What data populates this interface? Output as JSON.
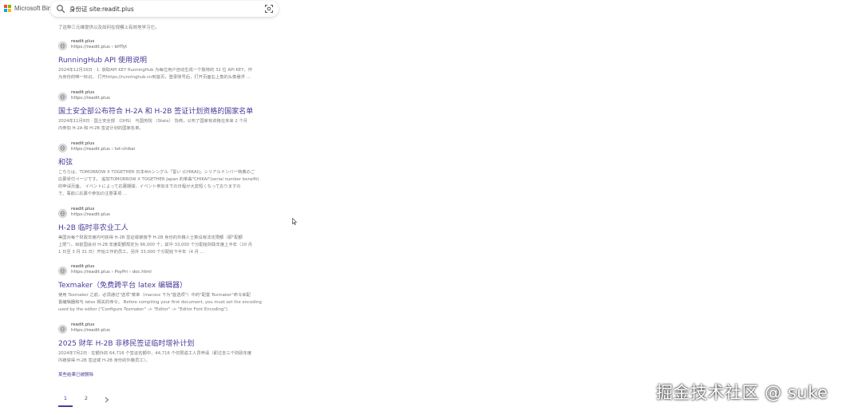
{
  "header": {
    "logo_text": "Microsoft Bing",
    "logo_colors": [
      "#f25022",
      "#7fba00",
      "#00a4ef",
      "#ffb900"
    ],
    "search_query": "身份证 site:readit.plus"
  },
  "top_snippet": {
    "line1": "",
    "line2": "了这种三元维提供以及如何在规模上有效地学习它。"
  },
  "results": [
    {
      "site_name": "readit.plus",
      "site_url": "https://readit.plus › bHTyt",
      "title": "RunningHub API 使用说明",
      "snippet": [
        "2024年12月16日 · 1. 获取API KEY RunningHub 为每位用户自动生成一个独特的 32 位 API KEY，作",
        "为身份的唯一标识。 打开https://runninghub.cn到首页，登录账号后，打开页面右上角的头像悬浮 …"
      ]
    },
    {
      "site_name": "readit.plus",
      "site_url": "https://readit.plus",
      "title": "国土安全部公布符合 H-2A 和 H-2B 签证计划资格的国家名单",
      "snippet": [
        "2024年11月8日 · 国土安全部 （DHS） 与国务院 （State） 协商，公布了国家有资格在未来 2 个月",
        "内参加 H-2A 和 H-2B 签证计划的国家名单。"
      ]
    },
    {
      "site_name": "readit.plus",
      "site_url": "https://readit.plus › txt-chikai",
      "title": "和弦",
      "snippet": [
        "こちらは、TOMORROW X TOGETHER 日本4thシングル「誓い (CHIKAI)」シリアルナンバー特典のご",
        "応募受付ページです。 追加TOMORROW X TOGETHER Japan 的单曲\"CHIKAI\"(serial number benefit)",
        "的申请页面。 イベントによって応募期間、イベント参加までの日程が大変短くなっておりますの",
        "で、事前に応募や参加の注意事項 …"
      ]
    },
    {
      "site_name": "readit.plus",
      "site_url": "https://readit.plus",
      "title": "H-2B 临时非农业工人",
      "snippet": [
        "美国对每个财政年度内可获得 H-2B 签证或被授予 H-2B 身份的外籍人士数设有法定限额（即\"配额",
        "上限\"）。目前国会对 H-2B 年度配额规定为 66,000 个，其中 33,000 个分配给财政年度上半年（10 月",
        "1 日至 3 月 31 日）开始工作的员工，另外 33,000 个分配给下半年（4 月 …"
      ]
    },
    {
      "site_name": "readit.plus",
      "site_url": "https://readit.plus › PsyPri › doc.html",
      "title": "Texmaker（免费跨平台 latex 编辑器）",
      "snippet": [
        "使用 Texmaker 之前，必须通过\"选项\"菜单（macosx 下为\"首选项\"）中的\"配置 Texmaker\"命令来配",
        "置编辑器和与 latex 相关的命令。 Before compiling your first document, you must set the encoding",
        "used by the editor (\"Configure Texmaker\" -> \"Editor\" -> \"Editor Font Encoding\")."
      ]
    },
    {
      "site_name": "readit.plus",
      "site_url": "https://readit.plus",
      "title": "2025 财年 H-2B 非移民签证临时增补计划",
      "snippet": [
        "2024年7月2日 · 在额外的 64,716 个签证名额中，44,716 个仅限返工人员申请（即过去三个财政年度",
        "内被获得 H-2B 签证或 H-2B 身份的外籍员工）。"
      ]
    }
  ],
  "more_link": "某些结果已被删除",
  "pagination": {
    "pages": [
      "1",
      "2"
    ],
    "active": "1"
  },
  "watermark": "掘金技术社区 @ suke",
  "accent_color": "#4b3b9a"
}
